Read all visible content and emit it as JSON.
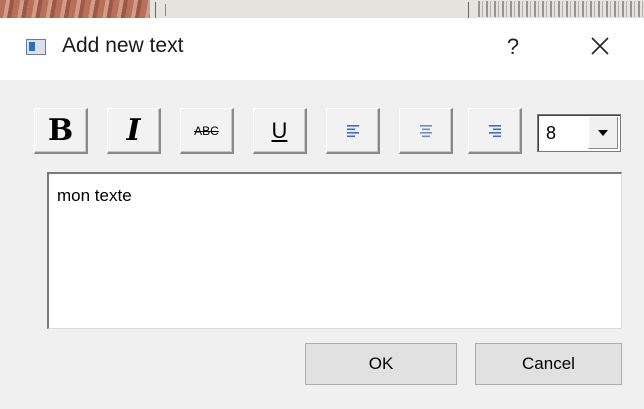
{
  "dialog": {
    "title": "Add new text",
    "help_label": "?",
    "toolbar": {
      "bold_label": "B",
      "italic_label": "I",
      "strike_label": "ABC",
      "underline_label": "U",
      "font_size": "8"
    },
    "text_value": "mon texte",
    "ok_label": "OK",
    "cancel_label": "Cancel"
  },
  "colors": {
    "dialog_bg": "#f0f0f0",
    "titlebar_bg": "#ffffff",
    "align_icon_blue": "#3a6fc4"
  },
  "icons": [
    "app-icon",
    "help-icon",
    "close-icon",
    "align-left-icon",
    "align-center-icon",
    "align-right-icon",
    "dropdown-arrow-icon"
  ]
}
